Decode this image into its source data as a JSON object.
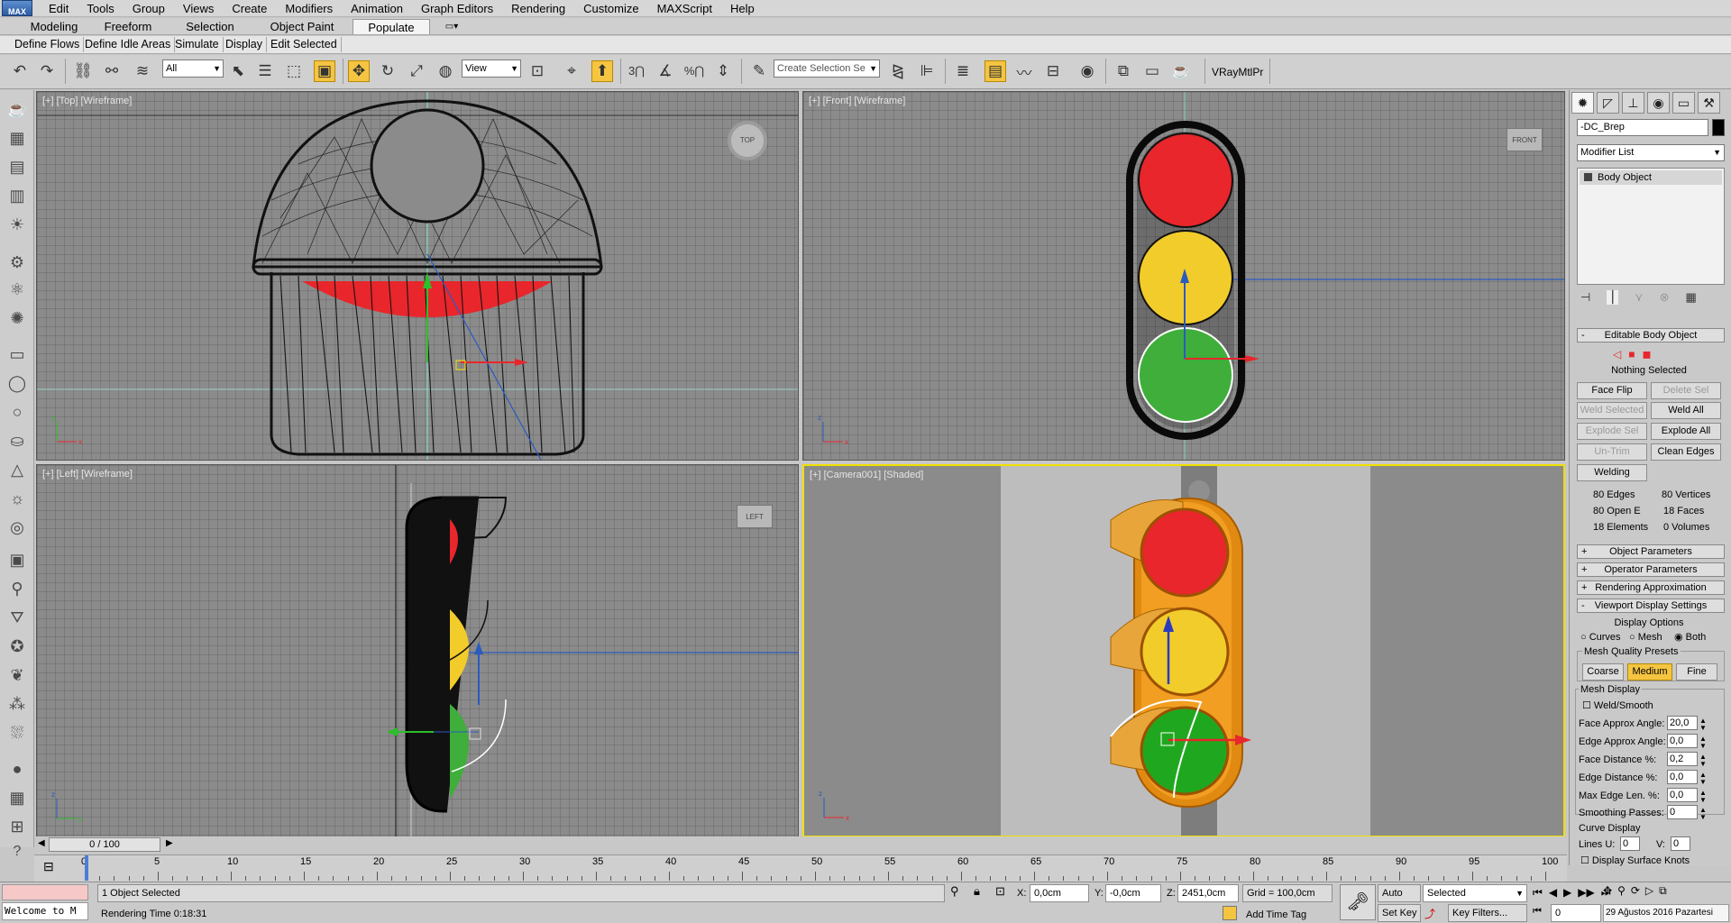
{
  "app": {
    "logo_text": "MAX"
  },
  "menu": [
    "Edit",
    "Tools",
    "Group",
    "Views",
    "Create",
    "Modifiers",
    "Animation",
    "Graph Editors",
    "Rendering",
    "Customize",
    "MAXScript",
    "Help"
  ],
  "ribbon": {
    "tabs": [
      "Modeling",
      "Freeform",
      "Selection",
      "Object Paint",
      "Populate"
    ],
    "active_tab": "Populate",
    "sub_tabs": [
      "Define Flows",
      "Define Idle Areas",
      "Simulate",
      "Display",
      "Edit Selected"
    ]
  },
  "toolbar": {
    "selection_filter": "All",
    "ref_coord": "View",
    "named_selection_placeholder": "Create Selection Se",
    "material_label": "VRayMtlPr"
  },
  "viewports": {
    "top": {
      "label": "[+] [Top] [Wireframe]",
      "cube": "TOP"
    },
    "front": {
      "label": "[+] [Front] [Wireframe]",
      "cube": "FRONT"
    },
    "left": {
      "label": "[+] [Left] [Wireframe]",
      "cube": "LEFT"
    },
    "camera": {
      "label": "[+] [Camera001] [Shaded]"
    }
  },
  "command_panel": {
    "object_name": "-DC_Brep",
    "modifier_list": "Modifier List",
    "stack_item": "Body Object",
    "rollout_editable": "Editable Body Object",
    "nothing_selected": "Nothing Selected",
    "buttons": {
      "face_flip": "Face Flip",
      "delete_sel": "Delete Sel",
      "weld_selected": "Weld Selected",
      "weld_all": "Weld All",
      "explode_sel": "Explode Sel",
      "explode_all": "Explode All",
      "un_trim": "Un-Trim",
      "clean_edges": "Clean Edges",
      "welding": "Welding"
    },
    "stats": {
      "edges": "80 Edges",
      "vertices": "80 Vertices",
      "open_e": "80 Open E",
      "faces": "18 Faces",
      "elements": "18 Elements",
      "volumes": "0 Volumes"
    },
    "rollouts": [
      "Object Parameters",
      "Operator Parameters",
      "Rendering Approximation",
      "Viewport Display Settings"
    ],
    "display_options": "Display Options",
    "radio_curves": "Curves",
    "radio_mesh": "Mesh",
    "radio_both": "Both",
    "mesh_quality_presets": "Mesh Quality Presets",
    "preset_coarse": "Coarse",
    "preset_medium": "Medium",
    "preset_fine": "Fine",
    "mesh_display": "Mesh Display",
    "weld_smooth": "Weld/Smooth",
    "params": [
      {
        "label": "Face Approx Angle:",
        "value": "20,0"
      },
      {
        "label": "Edge Approx Angle:",
        "value": "0,0"
      },
      {
        "label": "Face Distance %:",
        "value": "0,2"
      },
      {
        "label": "Edge Distance %:",
        "value": "0,0"
      },
      {
        "label": "Max Edge Len. %:",
        "value": "0,0"
      },
      {
        "label": "Smoothing Passes:",
        "value": "0"
      }
    ],
    "curve_display": "Curve Display",
    "lines_u_label": "Lines U:",
    "lines_u": "0",
    "lines_v_label": "V:",
    "lines_v": "0",
    "display_surface_knots": "Display Surface Knots"
  },
  "timeline": {
    "frame_display": "0 / 100",
    "ticks": [
      "0",
      "5",
      "10",
      "15",
      "20",
      "25",
      "30",
      "35",
      "40",
      "45",
      "50",
      "55",
      "60",
      "65",
      "70",
      "75",
      "80",
      "85",
      "90",
      "95",
      "100"
    ]
  },
  "status": {
    "maxscript": "Welcome to M",
    "selected": "1 Object Selected",
    "render_time": "Rendering Time  0:18:31",
    "x_label": "X:",
    "x": "0,0cm",
    "y_label": "Y:",
    "y": "-0,0cm",
    "z_label": "Z:",
    "z": "2451,0cm",
    "grid": "Grid = 100,0cm",
    "add_time_tag": "Add Time Tag",
    "auto_key": "Auto Key",
    "set_key": "Set Key",
    "key_mode": "Selected",
    "key_filters": "Key Filters...",
    "frame": "0",
    "date": "29 Ağustos 2016 Pazartesi"
  },
  "colors": {
    "red_lamp": "#e8262b",
    "yellow_lamp": "#f2cc2a",
    "green_lamp": "#3fae3a",
    "housing": "#e08a12",
    "highlight": "#f5c542"
  }
}
